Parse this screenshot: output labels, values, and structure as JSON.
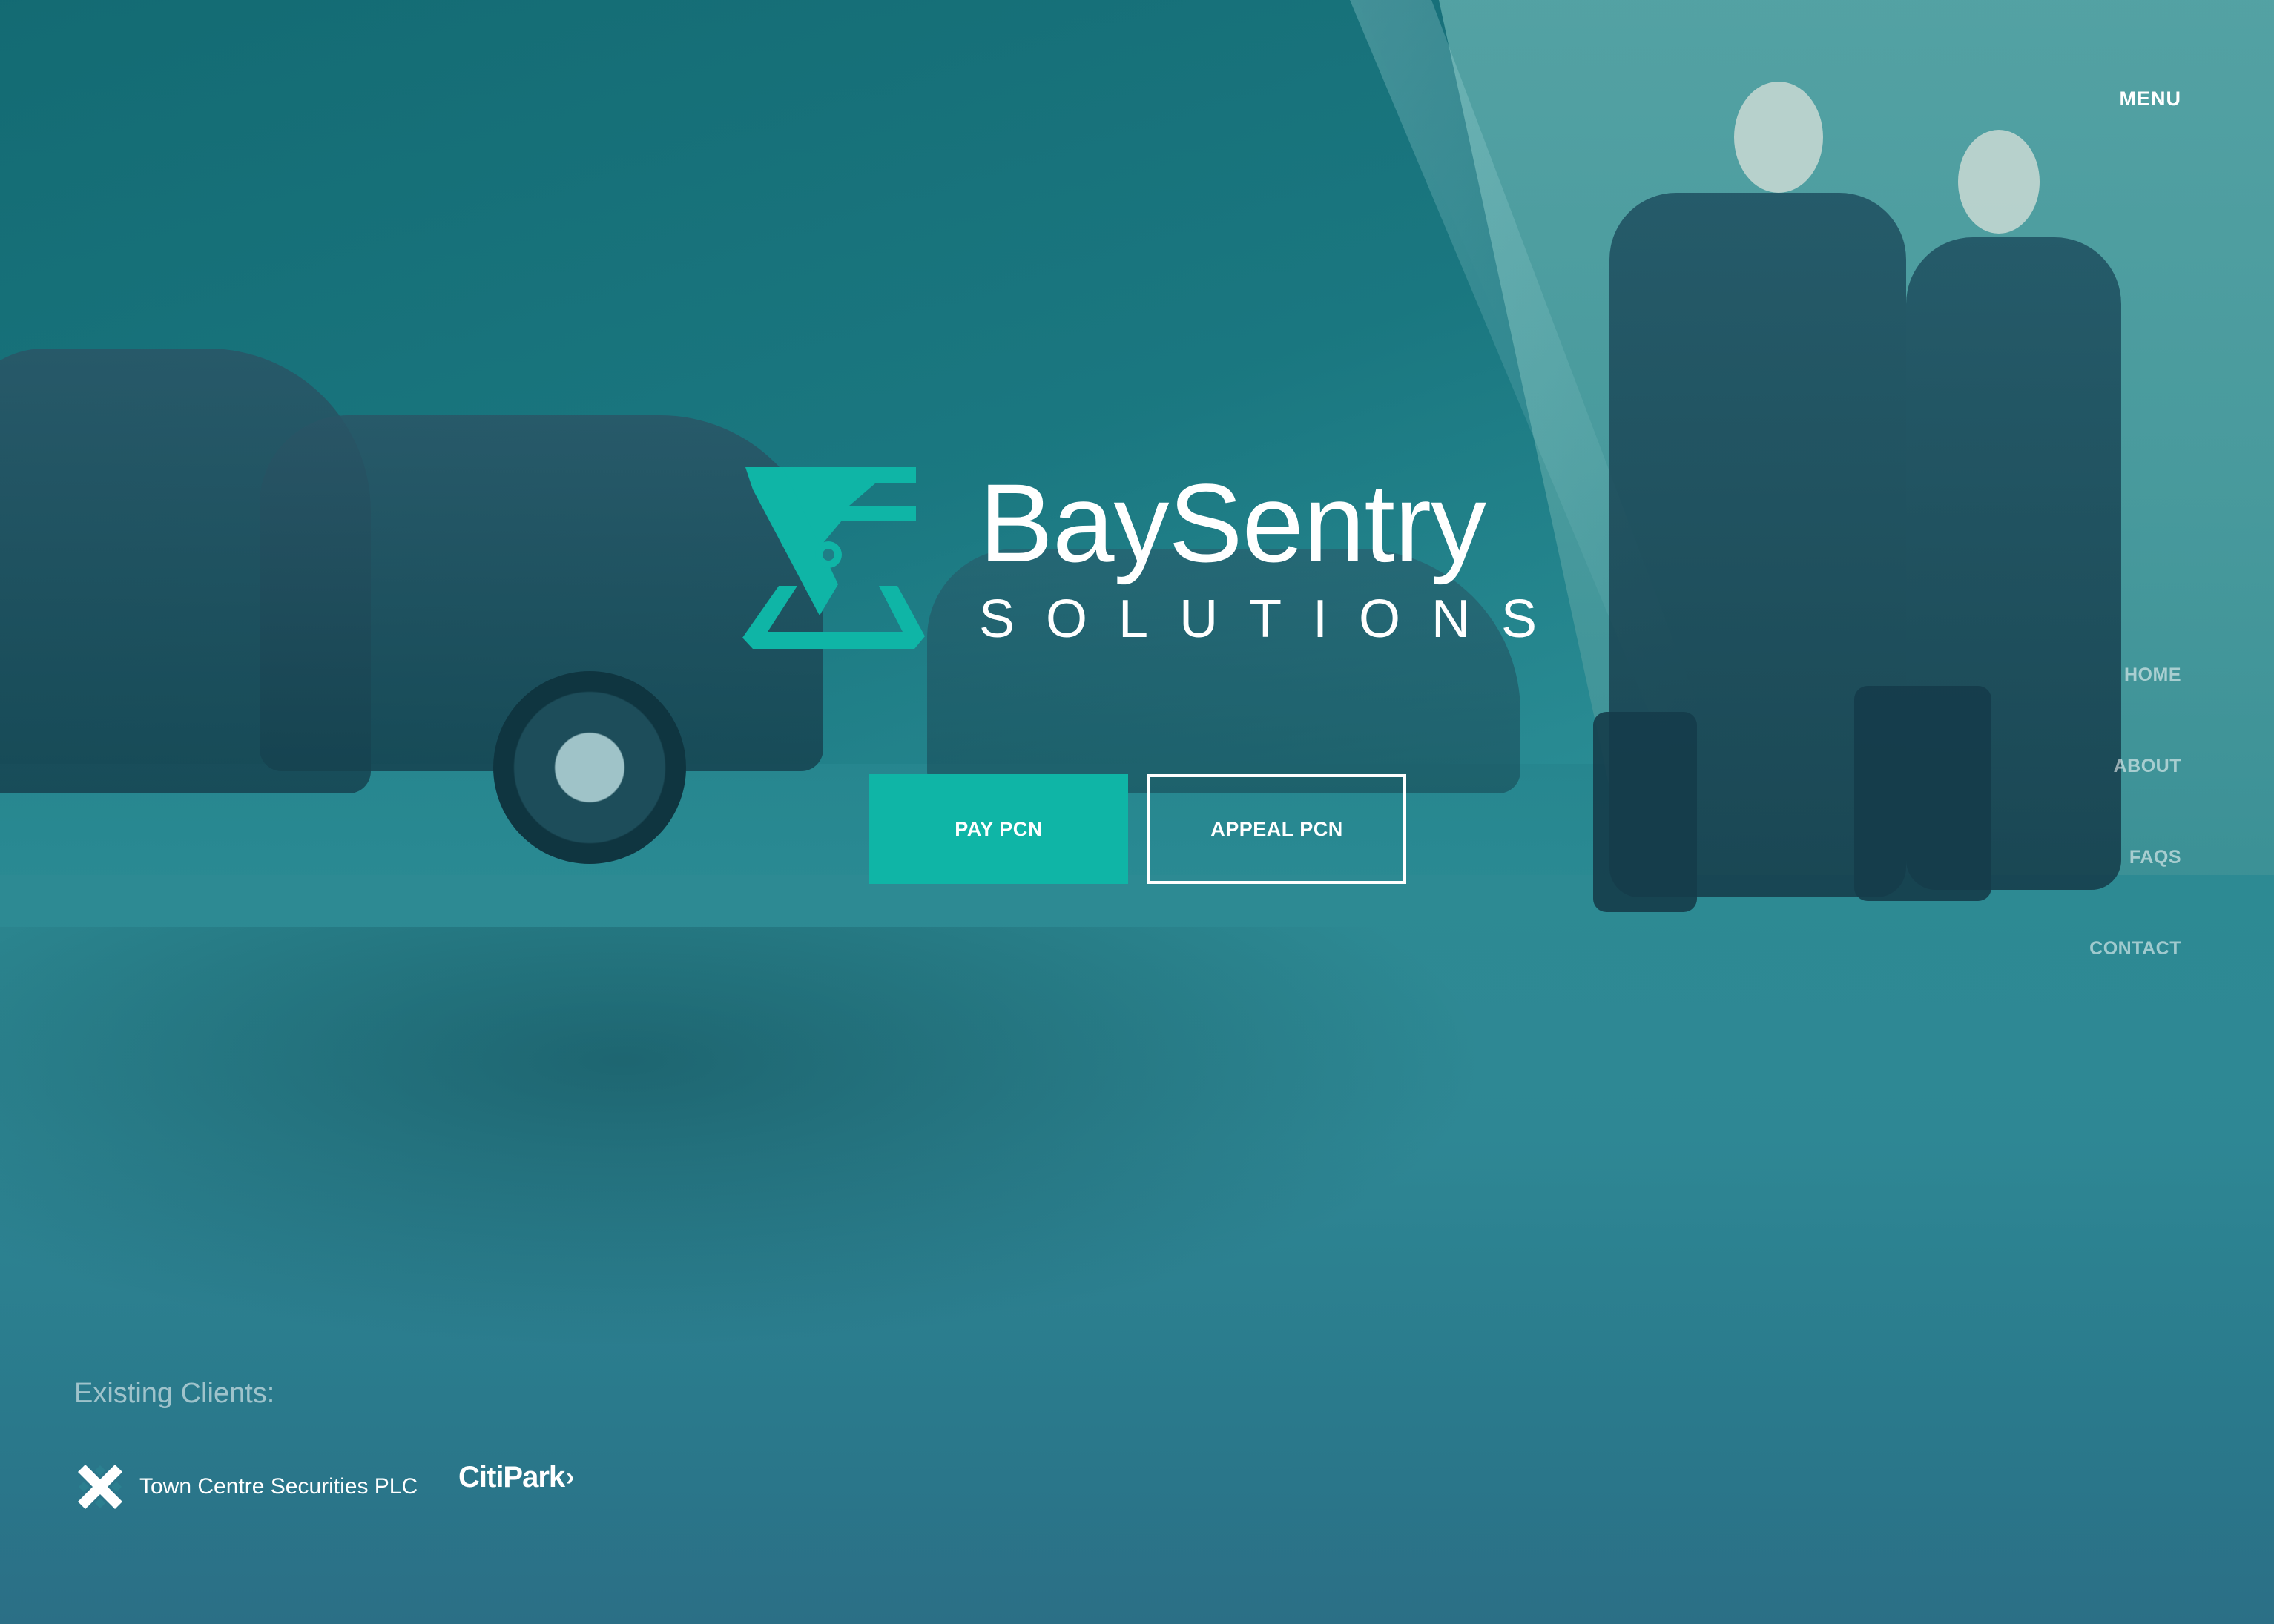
{
  "header": {
    "menu_label": "MENU"
  },
  "nav": {
    "items": [
      {
        "label": "HOME"
      },
      {
        "label": "ABOUT"
      },
      {
        "label": "FAQS"
      },
      {
        "label": "CONTACT"
      }
    ]
  },
  "brand": {
    "name": "BaySentry",
    "tagline": "SOLUTIONS",
    "accent": "#0fb5a6"
  },
  "actions": {
    "pay_label": "PAY PCN",
    "appeal_label": "APPEAL PCN"
  },
  "clients": {
    "label": "Existing Clients:",
    "items": [
      {
        "name": "Town Centre Securities PLC",
        "icon": "tcs-logo-icon"
      },
      {
        "name": "CitiPark",
        "icon": "citipark-logo"
      }
    ]
  }
}
